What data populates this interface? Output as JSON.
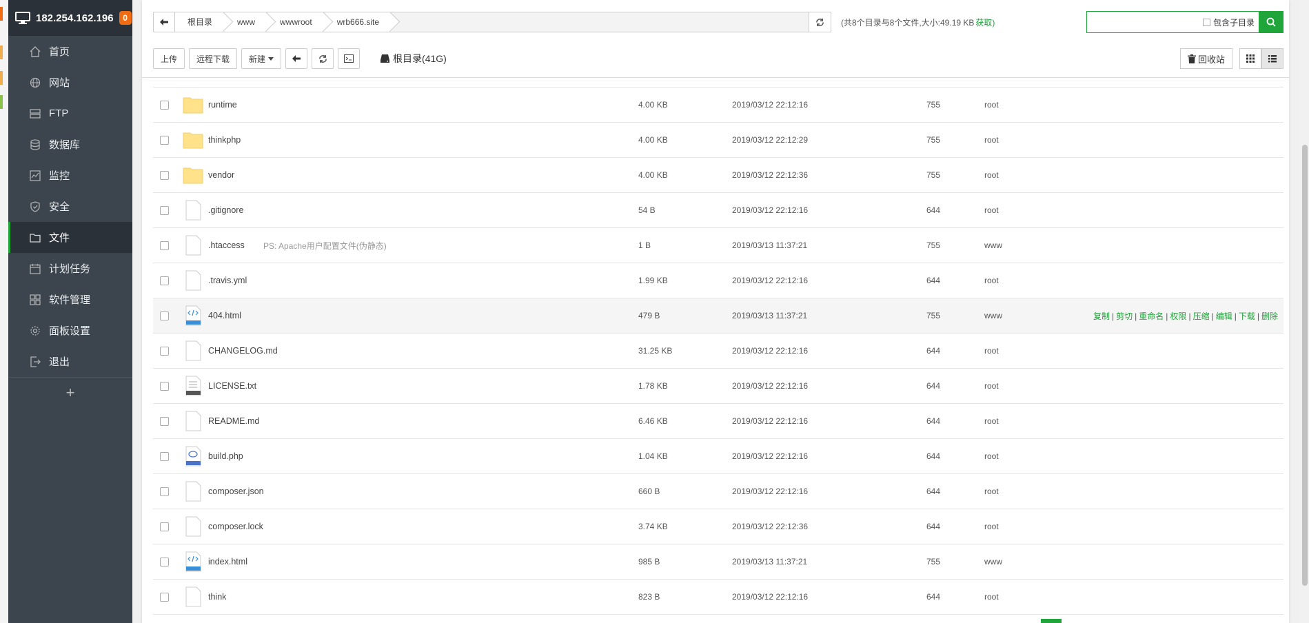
{
  "colors": {
    "accent": "#20a53a",
    "sidebar_bg": "#3c444d",
    "sidebar_head": "#2b3138",
    "badge": "#ef6c12"
  },
  "sidebar": {
    "ip": "182.254.162.196",
    "badge": "0",
    "items": [
      {
        "label": "首页",
        "icon": "home-icon"
      },
      {
        "label": "网站",
        "icon": "globe-icon"
      },
      {
        "label": "FTP",
        "icon": "ftp-icon"
      },
      {
        "label": "数据库",
        "icon": "database-icon"
      },
      {
        "label": "监控",
        "icon": "monitor-icon"
      },
      {
        "label": "安全",
        "icon": "shield-icon"
      },
      {
        "label": "文件",
        "icon": "folder-icon",
        "active": true
      },
      {
        "label": "计划任务",
        "icon": "calendar-icon"
      },
      {
        "label": "软件管理",
        "icon": "apps-icon"
      },
      {
        "label": "面板设置",
        "icon": "gear-icon"
      },
      {
        "label": "退出",
        "icon": "logout-icon"
      }
    ],
    "add_label": "+"
  },
  "path": {
    "crumbs": [
      "根目录",
      "www",
      "wwwroot",
      "wrb666.site"
    ],
    "summary": "(共8个目录与8个文件,大小:49.19 KB",
    "summary_link": "获取)"
  },
  "search": {
    "include_sub_label": "包含子目录",
    "value": ""
  },
  "toolbar": {
    "upload": "上传",
    "remote_download": "远程下载",
    "new": "新建",
    "disk": "根目录(41G)",
    "recycle": "回收站"
  },
  "files": [
    {
      "name": "runtime",
      "type": "folder",
      "size": "4.00 KB",
      "time": "2019/03/12 22:12:16",
      "perm": "755",
      "owner": "root"
    },
    {
      "name": "thinkphp",
      "type": "folder",
      "size": "4.00 KB",
      "time": "2019/03/12 22:12:29",
      "perm": "755",
      "owner": "root"
    },
    {
      "name": "vendor",
      "type": "folder",
      "size": "4.00 KB",
      "time": "2019/03/12 22:12:36",
      "perm": "755",
      "owner": "root"
    },
    {
      "name": ".gitignore",
      "type": "file",
      "size": "54 B",
      "time": "2019/03/12 22:12:16",
      "perm": "644",
      "owner": "root"
    },
    {
      "name": ".htaccess",
      "type": "file",
      "note": "PS: Apache用户配置文件(伪静态)",
      "size": "1 B",
      "time": "2019/03/13 11:37:21",
      "perm": "755",
      "owner": "www"
    },
    {
      "name": ".travis.yml",
      "type": "file",
      "size": "1.99 KB",
      "time": "2019/03/12 22:12:16",
      "perm": "644",
      "owner": "root"
    },
    {
      "name": "404.html",
      "type": "html",
      "size": "479 B",
      "time": "2019/03/13 11:37:21",
      "perm": "755",
      "owner": "www",
      "hover": true
    },
    {
      "name": "CHANGELOG.md",
      "type": "file",
      "size": "31.25 KB",
      "time": "2019/03/12 22:12:16",
      "perm": "644",
      "owner": "root"
    },
    {
      "name": "LICENSE.txt",
      "type": "txt",
      "size": "1.78 KB",
      "time": "2019/03/12 22:12:16",
      "perm": "644",
      "owner": "root"
    },
    {
      "name": "README.md",
      "type": "file",
      "size": "6.46 KB",
      "time": "2019/03/12 22:12:16",
      "perm": "644",
      "owner": "root"
    },
    {
      "name": "build.php",
      "type": "php",
      "size": "1.04 KB",
      "time": "2019/03/12 22:12:16",
      "perm": "644",
      "owner": "root"
    },
    {
      "name": "composer.json",
      "type": "file",
      "size": "660 B",
      "time": "2019/03/12 22:12:16",
      "perm": "644",
      "owner": "root"
    },
    {
      "name": "composer.lock",
      "type": "file",
      "size": "3.74 KB",
      "time": "2019/03/12 22:12:36",
      "perm": "644",
      "owner": "root"
    },
    {
      "name": "index.html",
      "type": "html",
      "size": "985 B",
      "time": "2019/03/13 11:37:21",
      "perm": "755",
      "owner": "www"
    },
    {
      "name": "think",
      "type": "file",
      "size": "823 B",
      "time": "2019/03/12 22:12:16",
      "perm": "644",
      "owner": "root"
    }
  ],
  "row_actions": [
    "复制",
    "剪切",
    "重命名",
    "权限",
    "压缩",
    "编辑",
    "下载",
    "删除"
  ]
}
